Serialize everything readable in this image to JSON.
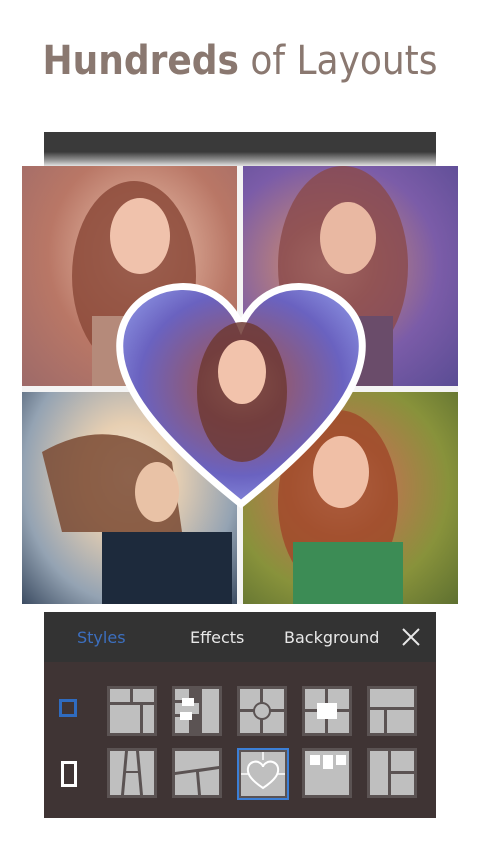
{
  "headline": {
    "bold": "Hundreds",
    "rest": " of Layouts"
  },
  "collage": {
    "cells": [
      {
        "name": "photo-top-left"
      },
      {
        "name": "photo-top-right"
      },
      {
        "name": "photo-bottom-left"
      },
      {
        "name": "photo-bottom-right"
      }
    ],
    "center_shape": "heart"
  },
  "toolbar": {
    "tabs": [
      {
        "label": "Styles",
        "active": true
      },
      {
        "label": "Effects",
        "active": false
      },
      {
        "label": "Background",
        "active": false
      }
    ],
    "close_icon": "close-icon"
  },
  "layouts": {
    "selected_index": 8,
    "rows": [
      "square",
      "portrait"
    ],
    "count": 10
  },
  "colors": {
    "accent": "#3c7fd6",
    "headline": "#8a7870",
    "panel": "#3f3434"
  }
}
